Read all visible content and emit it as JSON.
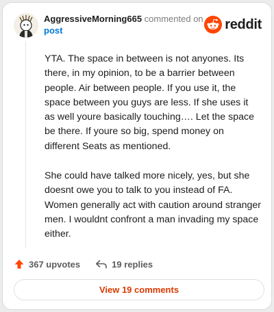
{
  "header": {
    "username": "AggressiveMorning665",
    "action_text": "commented on",
    "target_text": "post",
    "brand_name": "reddit",
    "brand_color": "#ff4500"
  },
  "comment": {
    "paragraphs": [
      "YTA. The space in between is not anyones. Its there, in my opinion, to be a barrier between people. Air between people. If you use it, the space between you guys are less. If she uses it as well youre basically touching…. Let the space be there. If youre so big, spend money on different Seats as mentioned.",
      "She could have talked more nicely, yes, but she doesnt owe you to talk to you instead of FA. Women generally act with caution around stranger men. I wouldnt confront a man invading my space either."
    ]
  },
  "actions": {
    "upvotes_label": "367 upvotes",
    "replies_label": "19 replies",
    "upvote_color": "#ff4500"
  },
  "footer": {
    "view_comments_label": "View 19 comments",
    "accent_color": "#d93900"
  },
  "icons": {
    "avatar": "avatar-image",
    "brand": "reddit-logo-icon",
    "upvote": "upvote-arrow-icon",
    "reply": "reply-arrow-icon"
  }
}
